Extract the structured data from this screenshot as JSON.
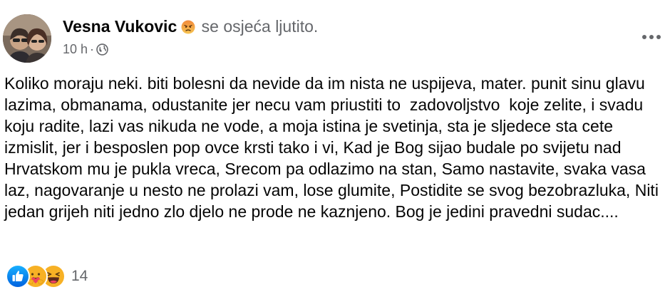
{
  "post": {
    "author": "Vesna Vukovic",
    "feeling": "se osjeća ljutito.",
    "time": "10 h",
    "separator": "·",
    "text": "Koliko moraju neki. biti bolesni da nevide da im nista ne uspijeva, mater. punit sinu glavu lazima, obmanama, odustanite jer necu vam priustiti to  zadovoljstvo  koje zelite, i svadu koju radite, lazi vas nikuda ne vode, a moja istina je svetinja, sta je sljedece sta cete izmislit, jer i besposlen pop ovce krsti tako i vi, Kad je Bog sijao budale po svijetu nad Hrvatskom mu je pukla vreca, Srecom pa odlazimo na stan, Samo nastavite, svaka vasa laz, nagovaranje u nesto ne prolazi vam, lose glumite, Postidite se svog bezobrazluka, Niti jedan grijeh niti jedno zlo djelo ne prode ne kaznjeno. Bog je jedini pravedni sudac....",
    "reaction_count": "14",
    "icons": {
      "feeling": "angry-emoji-icon",
      "privacy": "globe-icon",
      "more": "more-options-icon",
      "reactions": [
        "like-reaction-icon",
        "care-reaction-icon",
        "haha-reaction-icon"
      ]
    },
    "colors": {
      "like_blue": "#1877f2",
      "care_yellow": "#f7b125",
      "angry_orange": "#f0a13e",
      "secondary_text": "#65676b",
      "primary_text": "#050505"
    }
  }
}
